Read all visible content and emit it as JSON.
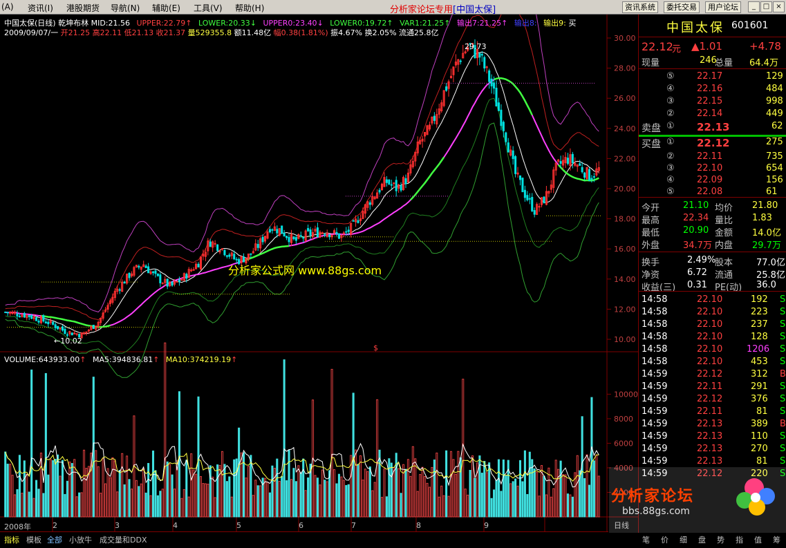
{
  "menu": {
    "items": [
      "(A)",
      "资讯(I)",
      "港股期货",
      "导航(N)",
      "辅助(E)",
      "工具(V)",
      "帮助(H)"
    ],
    "site_title": "分析家论坛专用",
    "stock_tag": "[中国太保]",
    "buttons": [
      "资讯系统",
      "委托交易",
      "用户论坛"
    ],
    "win": [
      "_",
      "□",
      "×"
    ]
  },
  "chart": {
    "row1": {
      "name": "中国太保(日线)",
      "indicator": "乾坤布林",
      "mid": "MID:21.56",
      "upper": "UPPER:22.79",
      "lower": "LOWER:20.33",
      "upper0": "UPPER0:23.40",
      "lower0": "LOWER0:19.72",
      "var1": "VAR1:21.25",
      "out7": "输出7:21.25",
      "out8": "输出8:",
      "out9": "输出9:",
      "buy": "买"
    },
    "row2": {
      "date": "2009/09/07/一",
      "open": "开21.25",
      "high": "高22.11",
      "low": "低21.13",
      "close": "收21.37",
      "vol": "量529355.8",
      "amt": "额11.48亿",
      "range": "幅0.38(1.81%)",
      "amp": "振4.67%",
      "turn": "换2.05%",
      "float": "流通25.8亿"
    },
    "yticks": [
      "30.00",
      "28.00",
      "26.00",
      "24.00",
      "22.00",
      "20.00",
      "18.00",
      "16.00",
      "14.00",
      "12.00",
      "10.00"
    ],
    "high_label": "29.73",
    "low_label": "10.02",
    "marker": "$",
    "watermark": "分析家公式网  www.88gs.com",
    "vol_row": {
      "vol": "VOLUME:643933.00",
      "ma5": "MA5:394836.81",
      "ma10": "MA10:374219.19"
    },
    "vol_ticks": [
      "10000",
      "8000",
      "6000",
      "4000",
      "2000"
    ],
    "xlabels": [
      "2008年",
      "2",
      "3",
      "4",
      "5",
      "6",
      "7",
      "8",
      "9"
    ],
    "period": "日线"
  },
  "quote": {
    "name": "中国太保",
    "code": "601601",
    "price": "22.12",
    "unit": "元",
    "change": "▲1.01",
    "pct": "+4.78",
    "now_label": "现量",
    "now_val": "246",
    "total_label": "总量",
    "total_val": "64.4万",
    "asks": [
      [
        "⑤",
        "22.17",
        "129"
      ],
      [
        "④",
        "22.16",
        "484"
      ],
      [
        "③",
        "22.15",
        "998"
      ],
      [
        "②",
        "22.14",
        "449"
      ]
    ],
    "ask1": [
      "卖盘",
      "①",
      "22.13",
      "62"
    ],
    "bid1": [
      "买盘",
      "①",
      "22.12",
      "275"
    ],
    "bids": [
      [
        "②",
        "22.11",
        "735"
      ],
      [
        "③",
        "22.10",
        "654"
      ],
      [
        "④",
        "22.09",
        "156"
      ],
      [
        "⑤",
        "22.08",
        "61"
      ]
    ],
    "stats": [
      [
        "今开",
        "21.10",
        "均价",
        "21.80"
      ],
      [
        "最高",
        "22.34",
        "量比",
        "1.83"
      ],
      [
        "最低",
        "20.90",
        "金额",
        "14.0亿"
      ],
      [
        "外盘",
        "34.7万",
        "内盘",
        "29.7万"
      ]
    ],
    "stats2": [
      [
        "换手",
        "2.49%",
        "股本",
        "77.0亿"
      ],
      [
        "净资",
        "6.72",
        "流通",
        "25.8亿"
      ],
      [
        "收益(三)",
        "0.31",
        "PE(动)",
        "36.0"
      ]
    ],
    "ticks": [
      [
        "14:58",
        "22.10",
        "192",
        "S"
      ],
      [
        "14:58",
        "22.10",
        "223",
        "S"
      ],
      [
        "14:58",
        "22.10",
        "237",
        "S"
      ],
      [
        "14:58",
        "22.10",
        "128",
        "S"
      ],
      [
        "14:58",
        "22.10",
        "1206",
        "S"
      ],
      [
        "14:58",
        "22.10",
        "453",
        "S"
      ],
      [
        "14:59",
        "22.12",
        "312",
        "B"
      ],
      [
        "14:59",
        "22.11",
        "291",
        "S"
      ],
      [
        "14:59",
        "22.12",
        "376",
        "S"
      ],
      [
        "14:59",
        "22.11",
        "81",
        "S"
      ],
      [
        "14:59",
        "22.13",
        "389",
        "B"
      ],
      [
        "14:59",
        "22.13",
        "110",
        "S"
      ],
      [
        "14:59",
        "22.13",
        "270",
        "S"
      ],
      [
        "14:59",
        "22.13",
        "81",
        "S"
      ],
      [
        "14:59",
        "22.12",
        "220",
        "S"
      ]
    ],
    "logo_text": "分析家论坛",
    "logo_url": "bbs.88gs.com"
  },
  "bottom": {
    "tabs": [
      "指标",
      "模板",
      "全部",
      "小放牛",
      "成交量和DDX"
    ],
    "rtabs": [
      "笔",
      "价",
      "细",
      "盘",
      "势",
      "指",
      "值",
      "筹"
    ]
  }
}
